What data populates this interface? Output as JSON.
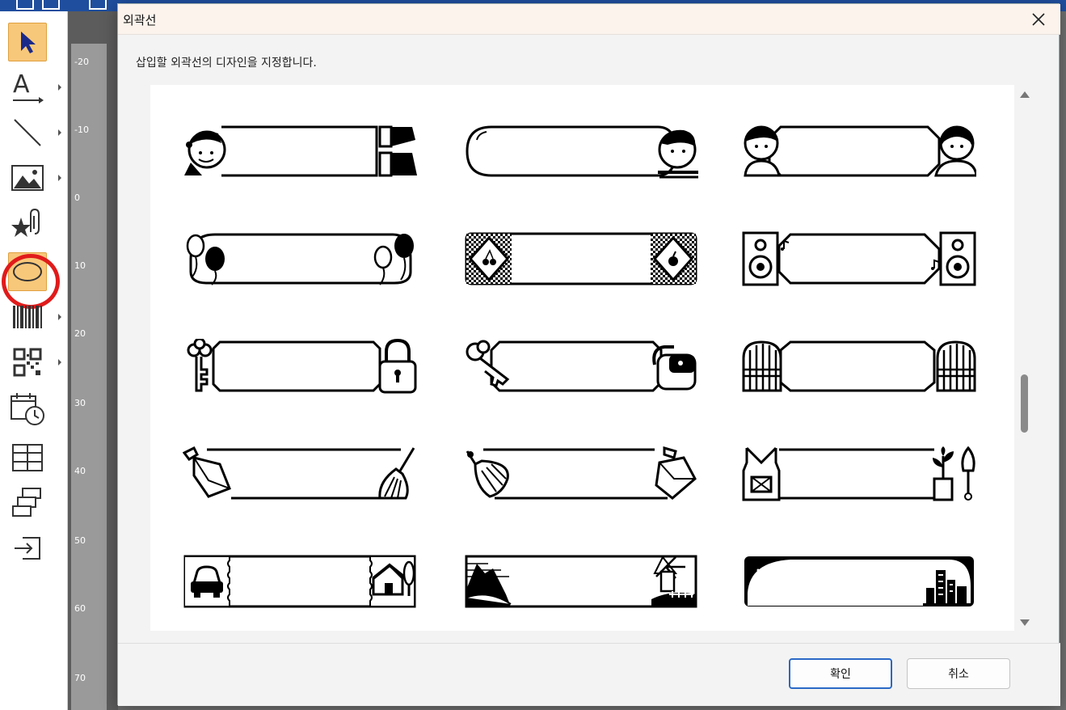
{
  "toolbar": {
    "tools": [
      {
        "name": "select-tool",
        "icon": "pointer-icon"
      },
      {
        "name": "text-tool",
        "icon": "text-icon"
      },
      {
        "name": "line-tool",
        "icon": "line-icon"
      },
      {
        "name": "image-tool",
        "icon": "image-icon"
      },
      {
        "name": "clipart-tool",
        "icon": "clipart-icon"
      },
      {
        "name": "frame-tool",
        "icon": "frame-icon"
      },
      {
        "name": "barcode-tool",
        "icon": "barcode-icon"
      },
      {
        "name": "qrcode-tool",
        "icon": "qrcode-icon"
      },
      {
        "name": "datetime-tool",
        "icon": "calendar-clock-icon"
      },
      {
        "name": "table-tool",
        "icon": "table-icon"
      },
      {
        "name": "numbering-tool",
        "icon": "numbering-icon"
      },
      {
        "name": "import-tool",
        "icon": "import-icon"
      }
    ],
    "accent": "#f8c87a",
    "highlight_ring": "#e11b1b"
  },
  "ruler": {
    "labels": [
      "-20",
      "-10",
      "0",
      "10",
      "20",
      "30",
      "40",
      "50",
      "60",
      "70"
    ]
  },
  "dialog": {
    "title": "외곽선",
    "instruction": "삽입할 외곽선의 디자인을 지정합니다.",
    "frames": [
      {
        "name": "frame-elf-boots",
        "icon": "elf-boots-icon"
      },
      {
        "name": "frame-round-boy",
        "icon": "boy-face-icon"
      },
      {
        "name": "frame-boy-girl",
        "icon": "boy-girl-icon"
      },
      {
        "name": "frame-balloons",
        "icon": "balloon-icon"
      },
      {
        "name": "frame-fruit-tiles",
        "icon": "fruit-tile-icon"
      },
      {
        "name": "frame-speakers",
        "icon": "speaker-icon"
      },
      {
        "name": "frame-key-lock",
        "icon": "key-lock-icon"
      },
      {
        "name": "frame-key-padlock",
        "icon": "key-padlock-icon"
      },
      {
        "name": "frame-gates",
        "icon": "gate-icon"
      },
      {
        "name": "frame-dustpan-broom",
        "icon": "dustpan-broom-icon"
      },
      {
        "name": "frame-broom-dustpan",
        "icon": "broom-dustpan-icon"
      },
      {
        "name": "frame-garden",
        "icon": "garden-icon"
      },
      {
        "name": "frame-car-house",
        "icon": "car-house-icon"
      },
      {
        "name": "frame-mountain-windmill",
        "icon": "mountain-windmill-icon"
      },
      {
        "name": "frame-night-city",
        "icon": "night-city-icon"
      }
    ],
    "ok_label": "확인",
    "cancel_label": "취소"
  }
}
